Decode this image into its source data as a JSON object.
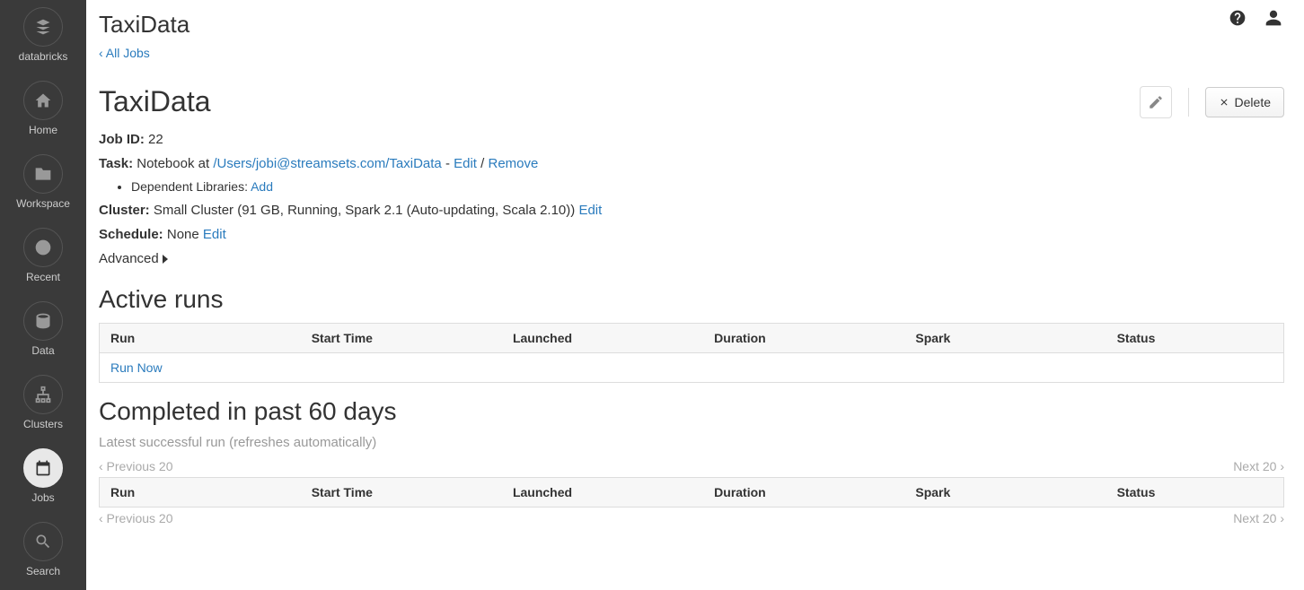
{
  "sidebar": {
    "brand": "databricks",
    "items": [
      {
        "label": "Home"
      },
      {
        "label": "Workspace"
      },
      {
        "label": "Recent"
      },
      {
        "label": "Data"
      },
      {
        "label": "Clusters"
      },
      {
        "label": "Jobs"
      },
      {
        "label": "Search"
      }
    ]
  },
  "header": {
    "title": "TaxiData",
    "breadcrumb": "‹ All Jobs"
  },
  "job": {
    "name": "TaxiData",
    "actions": {
      "delete": "Delete"
    },
    "id_label": "Job ID:",
    "id_value": "22",
    "task_label": "Task:",
    "task_prefix": "Notebook at ",
    "task_path": "/Users/jobi@streamsets.com/TaxiData",
    "task_sep1": " - ",
    "task_edit": "Edit",
    "task_sep2": " / ",
    "task_remove": "Remove",
    "deplib_label": "Dependent Libraries: ",
    "deplib_add": "Add",
    "cluster_label": "Cluster:",
    "cluster_value": "Small Cluster (91 GB, Running, Spark 2.1 (Auto-updating, Scala 2.10)) ",
    "cluster_edit": "Edit",
    "schedule_label": "Schedule:",
    "schedule_value": "None ",
    "schedule_edit": "Edit",
    "advanced": "Advanced"
  },
  "active_runs": {
    "title": "Active runs",
    "columns": [
      "Run",
      "Start Time",
      "Launched",
      "Duration",
      "Spark",
      "Status"
    ],
    "run_now": "Run Now"
  },
  "completed": {
    "title": "Completed in past 60 days",
    "subtitle": "Latest successful run (refreshes automatically)",
    "prev": "‹ Previous 20",
    "next": "Next 20 ›",
    "columns": [
      "Run",
      "Start Time",
      "Launched",
      "Duration",
      "Spark",
      "Status"
    ]
  }
}
